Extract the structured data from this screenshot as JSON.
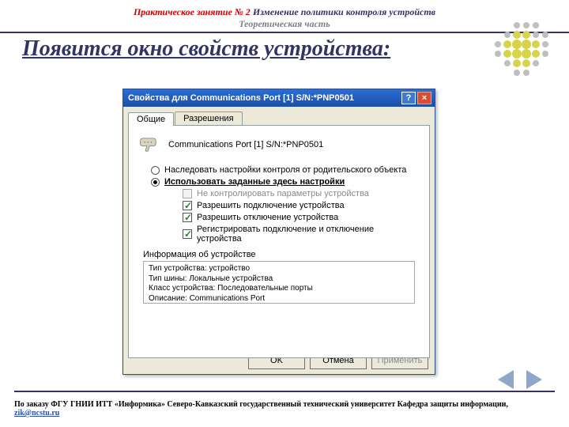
{
  "header": {
    "prefix": "Практическое занятие № 2",
    "title": " Изменение политики контроля устройств",
    "subtitle": "Теоретическая часть"
  },
  "slide_title": "Появится окно свойств устройства:",
  "dialog": {
    "title": "Свойства для Communications Port [1] S/N:*PNP0501",
    "tabs": {
      "general": "Общие",
      "permissions": "Разрешения"
    },
    "device_name": "Communications Port [1] S/N:*PNP0501",
    "radio_inherit": "Наследовать настройки контроля от родительского объекта",
    "radio_custom": "Использовать заданные здесь настройки",
    "chk_nocontrol": "Не контролировать параметры устройства",
    "chk_allow_connect": "Разрешить подключение устройства",
    "chk_allow_disconnect": "Разрешить отключение устройства",
    "chk_log": "Регистрировать подключение и отключение устройства",
    "info_label": "Информация об устройстве",
    "info_lines": {
      "l1": "Тип устройства: устройство",
      "l2": "Тип шины: Локальные устройства",
      "l3": "Класс устройства: Последовательные порты",
      "l4": "Описание: Communications Port"
    },
    "buttons": {
      "ok": "OK",
      "cancel": "Отмена",
      "apply": "Применить"
    }
  },
  "footer": {
    "text": "По заказу ФГУ ГНИИ ИТТ «Информика» Северо-Кавказский государственный технический университет Кафедра защиты информации,  ",
    "email": "zik@ncstu.ru"
  }
}
